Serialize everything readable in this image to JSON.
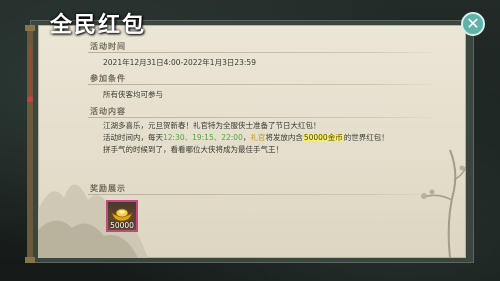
{
  "window": {
    "title": "全民红包",
    "close_symbol": "✕"
  },
  "sections": {
    "time": {
      "label": "活动时间",
      "value": "2021年12月31日4:00-2022年1月3日23:59"
    },
    "condition": {
      "label": "参加条件",
      "value": "所有侠客均可参与"
    },
    "content": {
      "label": "活动内容",
      "line1": "江湖多喜乐，元旦贺新春！礼官特为全服侠士准备了节日大红包！",
      "line2_prefix": "活动时间内，每天",
      "line2_times": "12:30、19:15、22:00",
      "line2_mid1": "，",
      "line2_who": "礼官",
      "line2_mid2": "将发放内含",
      "line2_amount": "50000金币",
      "line2_suffix": "的世界红包！",
      "line3": "拼手气的时候到了，看看哪位大侠将成为最佳手气王！"
    },
    "reward": {
      "label": "奖励展示",
      "item_icon": "gold-ingot-icon",
      "quantity": "50000"
    }
  },
  "colors": {
    "accent_green": "#4faa3c",
    "accent_yellow": "#c8961a",
    "reward_border": "#c04a86",
    "close_button": "#5fb2a8"
  }
}
